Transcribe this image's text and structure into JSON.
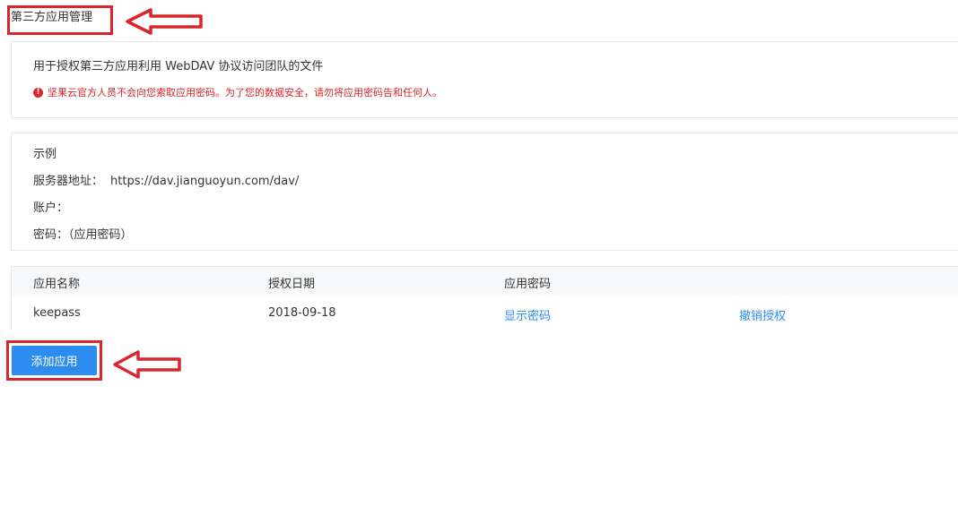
{
  "header": {
    "title": "第三方应用管理"
  },
  "info": {
    "description": "用于授权第三方应用利用 WebDAV 协议访问团队的文件",
    "warning_icon": "!",
    "warning": "坚果云官方人员不会向您索取应用密码。为了您的数据安全，请勿将应用密码告和任何人。"
  },
  "example": {
    "title": "示例",
    "server_label": "服务器地址：",
    "server_value": "https://dav.jianguoyun.com/dav/",
    "account_label": "账户：",
    "password_label": "密码：（应用密码）"
  },
  "table": {
    "headers": [
      "应用名称",
      "授权日期",
      "应用密码"
    ],
    "rows": [
      {
        "name": "keepass",
        "date": "2018-09-18",
        "show_password": "显示密码",
        "revoke": "撤销授权"
      }
    ]
  },
  "actions": {
    "add_label": "添加应用"
  },
  "colors": {
    "annotation_red": "#d9262c",
    "link_blue": "#2d8cf0",
    "button_blue": "#2d8cf0",
    "warning_red": "#d9262c"
  }
}
